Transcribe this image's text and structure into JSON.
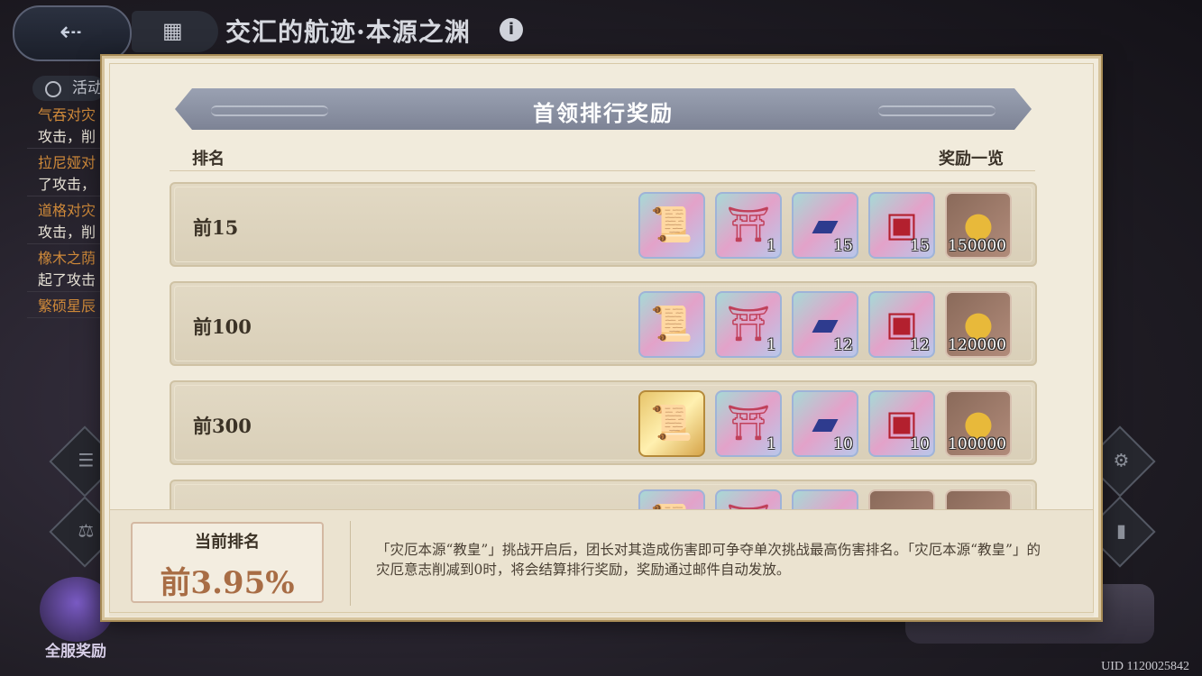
{
  "background": {
    "title": "交汇的航迹·本源之渊",
    "time_label": "活动",
    "log_entries": [
      {
        "name": "气吞对灾",
        "text": "攻击，削"
      },
      {
        "name": "拉尼娅对",
        "text": "了攻击，"
      },
      {
        "name": "道格对灾",
        "text": "攻击，削"
      },
      {
        "name": "橡木之荫",
        "text": "起了攻击"
      },
      {
        "name": "繁硕星辰",
        "text": ""
      }
    ],
    "server_reward_label": "全服奖励",
    "uid": "UID 1120025842"
  },
  "modal": {
    "title": "首领排行奖励",
    "col_rank": "排名",
    "col_rewards": "奖励一览",
    "rows": [
      {
        "rank": "前15",
        "items": [
          {
            "icon": "scroll-icon",
            "style": "rare",
            "count": ""
          },
          {
            "icon": "tower-icon",
            "style": "rare",
            "count": "1"
          },
          {
            "icon": "ticket-icon",
            "style": "rare",
            "count": "15"
          },
          {
            "icon": "chest-icon",
            "style": "rare",
            "count": "15"
          },
          {
            "icon": "coin-icon",
            "style": "bronze",
            "count": "150000"
          }
        ]
      },
      {
        "rank": "前100",
        "items": [
          {
            "icon": "scroll-icon",
            "style": "rare",
            "count": ""
          },
          {
            "icon": "tower-icon",
            "style": "rare",
            "count": "1"
          },
          {
            "icon": "ticket-icon",
            "style": "rare",
            "count": "12"
          },
          {
            "icon": "chest-icon",
            "style": "rare",
            "count": "12"
          },
          {
            "icon": "coin-icon",
            "style": "bronze",
            "count": "120000"
          }
        ]
      },
      {
        "rank": "前300",
        "items": [
          {
            "icon": "scroll-icon",
            "style": "gold",
            "count": ""
          },
          {
            "icon": "tower-icon",
            "style": "rare",
            "count": "1"
          },
          {
            "icon": "ticket-icon",
            "style": "rare",
            "count": "10"
          },
          {
            "icon": "chest-icon",
            "style": "rare",
            "count": "10"
          },
          {
            "icon": "coin-icon",
            "style": "bronze",
            "count": "100000"
          }
        ]
      },
      {
        "rank": "",
        "items": [
          {
            "icon": "scroll-icon",
            "style": "rare",
            "count": ""
          },
          {
            "icon": "tower-icon",
            "style": "rare",
            "count": ""
          },
          {
            "icon": "ticket-icon",
            "style": "rare",
            "count": ""
          },
          {
            "icon": "chest-icon",
            "style": "bronze",
            "count": ""
          },
          {
            "icon": "coin-icon",
            "style": "bronze",
            "count": ""
          }
        ]
      }
    ],
    "current_rank_label": "当前排名",
    "current_rank_value": "前3.95%",
    "description": "「灾厄本源“教皇”」挑战开启后，团长对其造成伤害即可争夺单次挑战最高伤害排名。「灾厄本源“教皇”」的灾厄意志削减到0时，将会结算排行奖励，奖励通过邮件自动发放。"
  }
}
